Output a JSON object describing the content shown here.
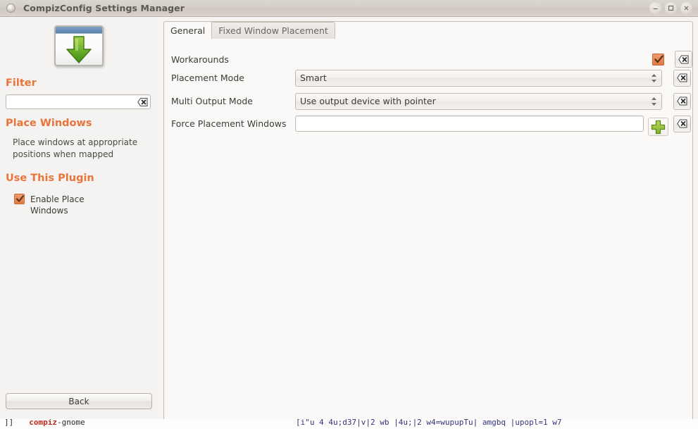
{
  "window": {
    "title": "CompizConfig Settings Manager",
    "menu_icon": "window-menu-icon",
    "buttons": [
      {
        "name": "minimize",
        "glyph": "minimize-icon"
      },
      {
        "name": "maximize",
        "glyph": "maximize-icon"
      },
      {
        "name": "close",
        "glyph": "close-icon"
      }
    ]
  },
  "sidebar": {
    "plugin_icon": "place-windows-icon",
    "filter_heading": "Filter",
    "filter_value": "",
    "filter_placeholder": "",
    "filter_clear_icon": "clear-icon",
    "plugin_heading": "Place Windows",
    "plugin_description": "Place windows at appropriate positions when mapped",
    "use_plugin_heading": "Use This Plugin",
    "enable_checkbox_label": "Enable Place Windows",
    "enable_checkbox_checked": true,
    "back_label": "Back"
  },
  "tabs": [
    {
      "label": "General",
      "active": true
    },
    {
      "label": "Fixed Window Placement",
      "active": false
    }
  ],
  "settings": {
    "rows": [
      {
        "label": "Workarounds",
        "type": "checkbox",
        "checked": true,
        "reset_icon": "reset-icon"
      },
      {
        "label": "Placement Mode",
        "type": "combo",
        "value": "Smart",
        "reset_icon": "reset-icon"
      },
      {
        "label": "Multi Output Mode",
        "type": "combo",
        "value": "Use output device with pointer",
        "reset_icon": "reset-icon"
      },
      {
        "label": "Force Placement Windows",
        "type": "text-with-add",
        "value": "",
        "placeholder": "",
        "add_icon": "add-icon",
        "reset_icon": "reset-icon"
      }
    ]
  },
  "bottom_strip": {
    "segments": [
      {
        "text": "]]",
        "color": "dark"
      },
      {
        "text": "compiz",
        "color": "red"
      },
      {
        "text": "-gnome",
        "color": "dark"
      }
    ],
    "right_text": "[i\"u  4  4u;d37|v|2  wb  |4u;|2  w4=wupupTu|              amgbq           |upopl=1  w7"
  },
  "colors": {
    "accent_orange": "#e8743c",
    "checkbox_orange": "#e07b44",
    "add_green": "#8cbf3f",
    "panel_bg": "#faf9f8",
    "sidebar_bg": "#f5f3f1",
    "titlebar_bg": "#d4cec8"
  }
}
